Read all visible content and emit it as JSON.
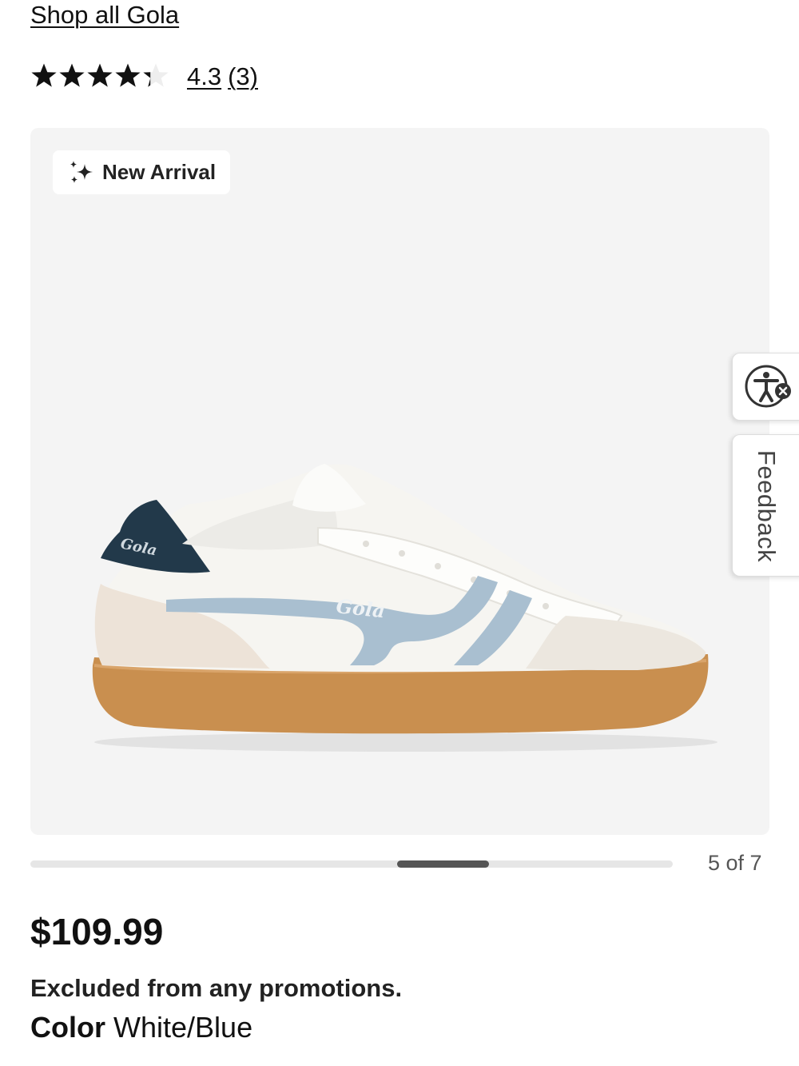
{
  "header": {
    "shop_link": "Shop all Gola"
  },
  "rating": {
    "value": 4.3,
    "value_label": "4.3",
    "count_label": "(3)",
    "max_stars": 5,
    "star_color": "#111111"
  },
  "gallery": {
    "badge_icon": "sparkle-icon",
    "badge_label": "New Arrival",
    "brand_text_on_shoe": "Gola",
    "current_index": 5,
    "total": 7,
    "counter_label": "5 of 7",
    "background": "#f4f4f4"
  },
  "side_tabs": {
    "accessibility_icon": "accessibility-icon",
    "feedback_label": "Feedback"
  },
  "product": {
    "price": "$109.99",
    "promo_note": "Excluded from any promotions.",
    "color_label": "Color",
    "color_value": "White/Blue"
  }
}
